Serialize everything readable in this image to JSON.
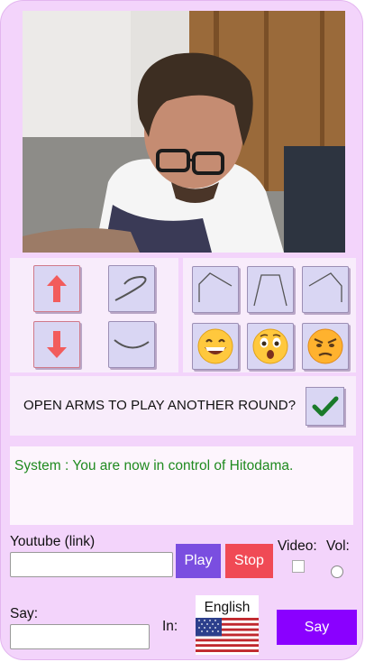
{
  "camera": {
    "icon": "webcam-video-feed"
  },
  "movement_controls": [
    {
      "name": "arm-up",
      "icon": "arrow-up-icon",
      "color": "#f25c5c"
    },
    {
      "name": "gesture-wave",
      "icon": "squiggle-icon",
      "color": "#555555"
    },
    {
      "name": "arm-down",
      "icon": "arrow-down-icon",
      "color": "#f25c5c"
    },
    {
      "name": "gesture-smile",
      "icon": "smile-curve-icon",
      "color": "#555555"
    }
  ],
  "pose_controls": [
    {
      "name": "pose-pentagon",
      "icon": "pentagon-outline-icon"
    },
    {
      "name": "pose-trapezoid",
      "icon": "trapezoid-outline-icon"
    },
    {
      "name": "pose-house",
      "icon": "house-outline-icon"
    },
    {
      "name": "emoji-grin",
      "icon": "grinning-face-icon"
    },
    {
      "name": "emoji-surprised",
      "icon": "surprised-face-icon"
    },
    {
      "name": "emoji-angry",
      "icon": "angry-face-icon"
    }
  ],
  "prompt": {
    "question": "OPEN ARMS TO PLAY ANOTHER ROUND?",
    "confirm_icon": "checkmark-icon"
  },
  "log": {
    "message": "System : You are now in control of Hitodama."
  },
  "youtube": {
    "label": "Youtube (link)",
    "value": "",
    "play_label": "Play",
    "stop_label": "Stop",
    "video_label": "Video:",
    "vol_label": "Vol:"
  },
  "say": {
    "label": "Say:",
    "value": "",
    "in_label": "In:",
    "language": "English",
    "flag_icon": "us-flag-icon",
    "button_label": "Say"
  },
  "colors": {
    "background": "#f3d4fb",
    "play": "#7a4ee0",
    "stop": "#f04a55",
    "say": "#8a00ff",
    "log_text": "#1f8a1f"
  }
}
